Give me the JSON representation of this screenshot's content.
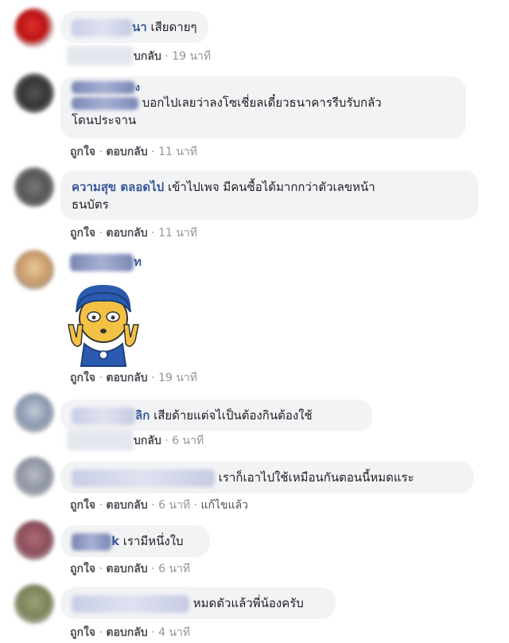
{
  "comments": [
    {
      "name_visible": "นา",
      "text": "เสียดายๆ",
      "reply": "บกลับ",
      "time": "19 นาที"
    },
    {
      "name_visible": "ง",
      "text": "บอกไปเลยว่าลงโซเชี่ยลเดี๋ยวธนาคารรีบรับกลัว",
      "text2": "โดนประจาน",
      "like": "ถูกใจ",
      "reply": "ตอบกลับ",
      "time": "11 นาที"
    },
    {
      "name": "ความสุข ตลอดไป",
      "text": "เข้าไปเพจ มีคนซื้อได้มากกว่าตัวเลขหน้า",
      "text2": "ธนบัตร",
      "like": "ถูกใจ",
      "reply": "ตอบกลับ",
      "time": "11 นาที"
    },
    {
      "name_visible": "ท",
      "like": "ถูกใจ",
      "reply": "ตอบกลับ",
      "time": "19 นาที"
    },
    {
      "name_visible": "ลิก",
      "text": "เสียด้ายแต่จไเป็นต้องกินต้องใช้",
      "reply": "บกลับ",
      "time": "6 นาที"
    },
    {
      "text": "เราก็เอาไปใช้เหมือนกันตอนนี้หมดแระ",
      "like": "ถูกใจ",
      "reply": "ตอบกลับ",
      "time": "6 นาที",
      "edited": "แก้ไขแล้ว"
    },
    {
      "name_visible": "k",
      "text": "เรามีหนึ่งใบ",
      "like": "ถูกใจ",
      "reply": "ตอบกลับ",
      "time": "6 นาที"
    },
    {
      "text": "หมดตัวแล้วพี่น้องครับ",
      "like": "ถูกใจ",
      "reply": "ตอบกลับ",
      "time": "4 นาที"
    }
  ],
  "sep": "·",
  "colors": {
    "name": "#385898",
    "bubble": "#f2f3f5",
    "meta": "#90949c"
  }
}
